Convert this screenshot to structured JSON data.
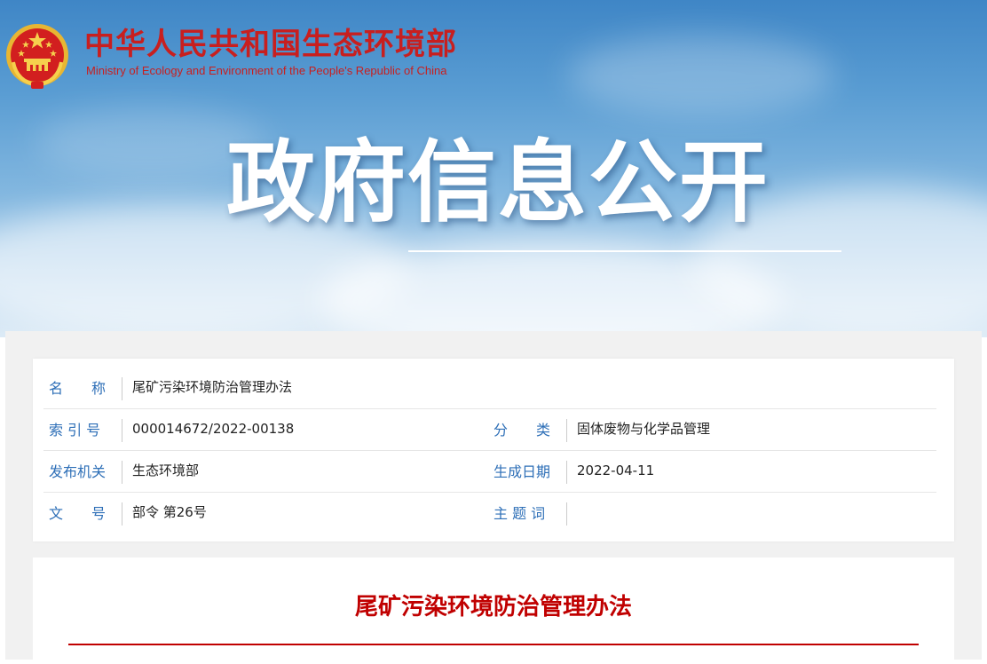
{
  "header": {
    "ministry_cn": "中华人民共和国生态环境部",
    "ministry_en": "Ministry of Ecology and Environment of the People's Republic of China",
    "section_title": "政府信息公开",
    "brand_color": "#c81f1f",
    "emblem_icon": "national-emblem-icon"
  },
  "metadata": {
    "name_label": "名　　称",
    "name_value": "尾矿污染环境防治管理办法",
    "index_label": "索 引 号",
    "index_value": "000014672/2022-00138",
    "category_label": "分　　类",
    "category_value": "固体废物与化学品管理",
    "issuer_label": "发布机关",
    "issuer_value": "生态环境部",
    "date_label": "生成日期",
    "date_value": "2022-04-11",
    "doc_no_label": "文　　号",
    "doc_no_value": "部令 第26号",
    "keywords_label": "主 题 词",
    "keywords_value": "",
    "label_color": "#2e6fb7"
  },
  "article": {
    "title": "尾矿污染环境防治管理办法",
    "title_color": "#c00000"
  }
}
